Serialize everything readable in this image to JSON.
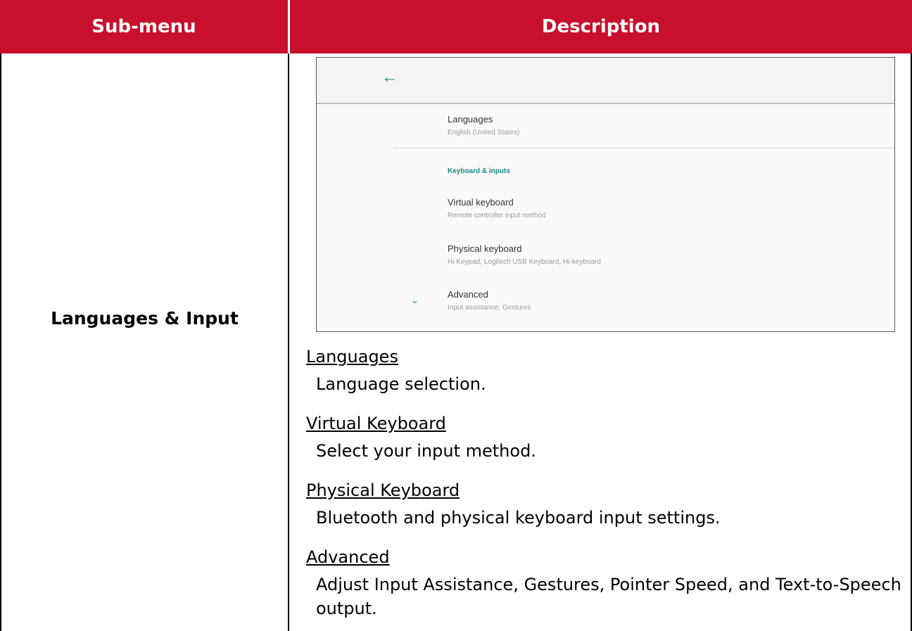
{
  "header": {
    "submenu": "Sub-menu",
    "description": "Description"
  },
  "submenu_label": "Languages & Input",
  "screenshot": {
    "back_icon": "arrow-left-icon",
    "languages_title": "Languages",
    "languages_sub": "English (United States)",
    "section_label": "Keyboard & inputs",
    "virtual_title": "Virtual keyboard",
    "virtual_sub": "Remote controller input method",
    "physical_title": "Physical keyboard",
    "physical_sub": "Hi Keypad, Logitech USB Keyboard, Hi-keyboard",
    "advanced_title": "Advanced",
    "advanced_sub": "Input assistance, Gestures",
    "advanced_icon": "chevron-down-icon"
  },
  "items": [
    {
      "title": "Languages",
      "desc": "Language selection."
    },
    {
      "title": "Virtual Keyboard",
      "desc": "Select your input method."
    },
    {
      "title": "Physical Keyboard",
      "desc": "Bluetooth and physical keyboard input settings."
    },
    {
      "title": "Advanced",
      "desc": "Adjust Input Assistance, Gestures, Pointer Speed, and Text-to-Speech output."
    }
  ],
  "colors": {
    "header_bg": "#c8102e",
    "accent": "#128a84"
  }
}
